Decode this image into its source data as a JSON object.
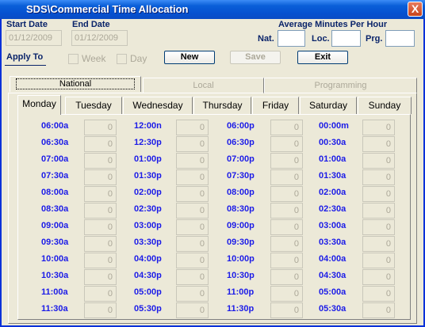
{
  "window": {
    "title": "SDS\\Commercial Time Allocation",
    "close_label": "X"
  },
  "dates": {
    "start_label": "Start Date",
    "start_value": "01/12/2009",
    "end_label": "End Date",
    "end_value": "01/12/2009"
  },
  "average": {
    "title": "Average Minutes Per Hour",
    "nat_label": "Nat.",
    "nat_value": "",
    "loc_label": "Loc.",
    "loc_value": "",
    "prg_label": "Prg.",
    "prg_value": ""
  },
  "apply_to": {
    "label": "Apply To",
    "week_label": "Week",
    "day_label": "Day"
  },
  "buttons": {
    "new": "New",
    "save": "Save",
    "exit": "Exit"
  },
  "top_tabs": [
    "National",
    "Local",
    "Programming"
  ],
  "day_tabs": [
    "Monday",
    "Tuesday",
    "Wednesday",
    "Thursday",
    "Friday",
    "Saturday",
    "Sunday"
  ],
  "slots": [
    [
      {
        "time": "06:00a",
        "value": "0"
      },
      {
        "time": "06:30a",
        "value": "0"
      },
      {
        "time": "07:00a",
        "value": "0"
      },
      {
        "time": "07:30a",
        "value": "0"
      },
      {
        "time": "08:00a",
        "value": "0"
      },
      {
        "time": "08:30a",
        "value": "0"
      },
      {
        "time": "09:00a",
        "value": "0"
      },
      {
        "time": "09:30a",
        "value": "0"
      },
      {
        "time": "10:00a",
        "value": "0"
      },
      {
        "time": "10:30a",
        "value": "0"
      },
      {
        "time": "11:00a",
        "value": "0"
      },
      {
        "time": "11:30a",
        "value": "0"
      }
    ],
    [
      {
        "time": "12:00n",
        "value": "0"
      },
      {
        "time": "12:30p",
        "value": "0"
      },
      {
        "time": "01:00p",
        "value": "0"
      },
      {
        "time": "01:30p",
        "value": "0"
      },
      {
        "time": "02:00p",
        "value": "0"
      },
      {
        "time": "02:30p",
        "value": "0"
      },
      {
        "time": "03:00p",
        "value": "0"
      },
      {
        "time": "03:30p",
        "value": "0"
      },
      {
        "time": "04:00p",
        "value": "0"
      },
      {
        "time": "04:30p",
        "value": "0"
      },
      {
        "time": "05:00p",
        "value": "0"
      },
      {
        "time": "05:30p",
        "value": "0"
      }
    ],
    [
      {
        "time": "06:00p",
        "value": "0"
      },
      {
        "time": "06:30p",
        "value": "0"
      },
      {
        "time": "07:00p",
        "value": "0"
      },
      {
        "time": "07:30p",
        "value": "0"
      },
      {
        "time": "08:00p",
        "value": "0"
      },
      {
        "time": "08:30p",
        "value": "0"
      },
      {
        "time": "09:00p",
        "value": "0"
      },
      {
        "time": "09:30p",
        "value": "0"
      },
      {
        "time": "10:00p",
        "value": "0"
      },
      {
        "time": "10:30p",
        "value": "0"
      },
      {
        "time": "11:00p",
        "value": "0"
      },
      {
        "time": "11:30p",
        "value": "0"
      }
    ],
    [
      {
        "time": "00:00m",
        "value": "0"
      },
      {
        "time": "00:30a",
        "value": "0"
      },
      {
        "time": "01:00a",
        "value": "0"
      },
      {
        "time": "01:30a",
        "value": "0"
      },
      {
        "time": "02:00a",
        "value": "0"
      },
      {
        "time": "02:30a",
        "value": "0"
      },
      {
        "time": "03:00a",
        "value": "0"
      },
      {
        "time": "03:30a",
        "value": "0"
      },
      {
        "time": "04:00a",
        "value": "0"
      },
      {
        "time": "04:30a",
        "value": "0"
      },
      {
        "time": "05:00a",
        "value": "0"
      },
      {
        "time": "05:30a",
        "value": "0"
      }
    ]
  ]
}
